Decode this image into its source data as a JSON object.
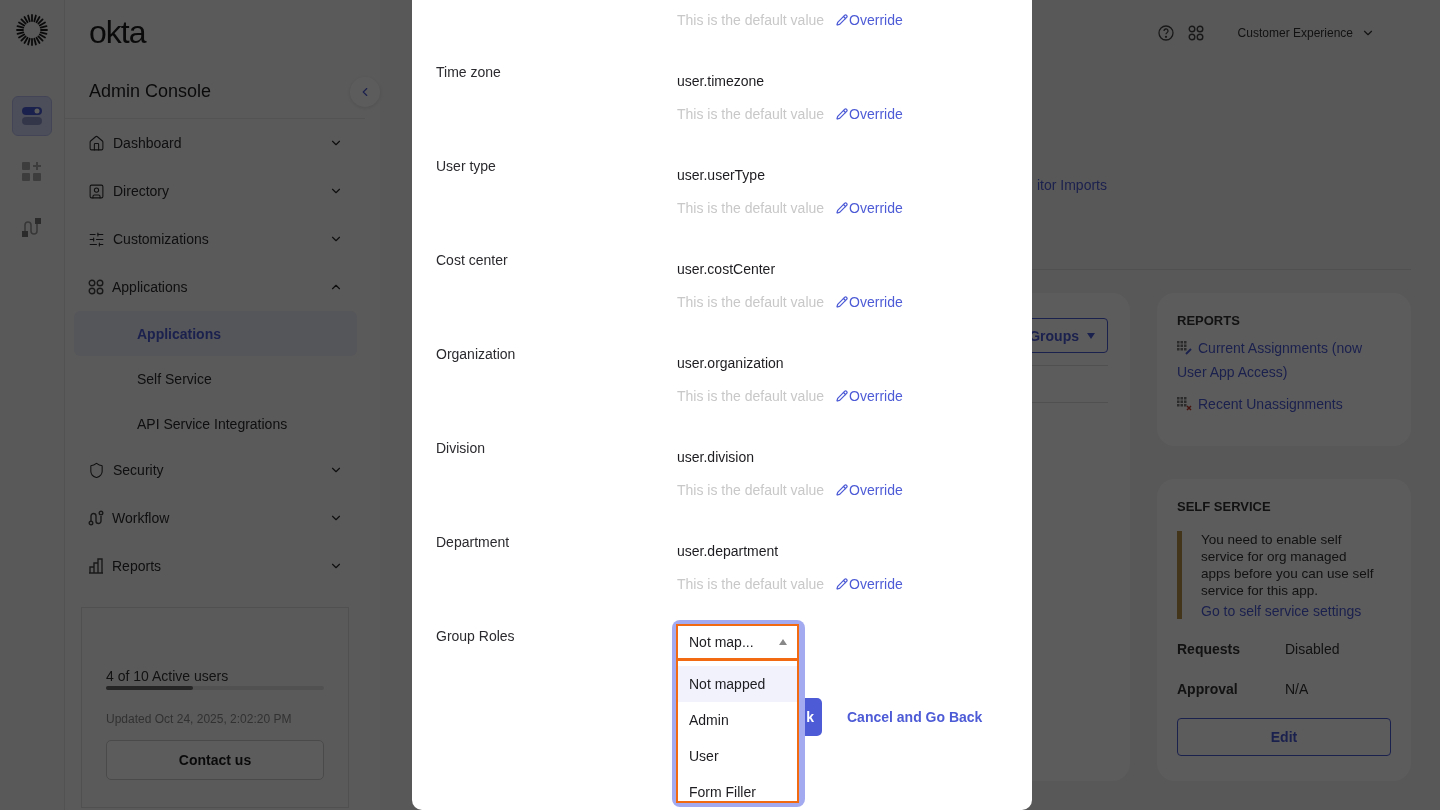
{
  "rail": {
    "items": [
      {
        "selected": true
      },
      {
        "selected": false
      },
      {
        "selected": false
      }
    ]
  },
  "logo": "okta",
  "sidebar": {
    "title": "Admin Console",
    "items": [
      {
        "label": "Dashboard",
        "expanded": false
      },
      {
        "label": "Directory",
        "expanded": false
      },
      {
        "label": "Customizations",
        "expanded": false
      },
      {
        "label": "Applications",
        "expanded": true,
        "children": [
          {
            "label": "Applications",
            "selected": true
          },
          {
            "label": "Self Service",
            "selected": false
          },
          {
            "label": "API Service Integrations",
            "selected": false
          }
        ]
      },
      {
        "label": "Security",
        "expanded": false
      },
      {
        "label": "Workflow",
        "expanded": false
      },
      {
        "label": "Reports",
        "expanded": false
      }
    ]
  },
  "usage_card": {
    "text": "4 of 10 Active users",
    "level": 0.4,
    "updated": "Updated Oct 24, 2025, 2:02:20 PM",
    "button": "Contact us"
  },
  "header": {
    "org": "Customer Experience"
  },
  "main": {
    "link": "itor Imports",
    "groups_button": "Groups"
  },
  "reports": {
    "title": "REPORTS",
    "links": [
      {
        "kind": "edit",
        "label": "Current Assignments (now User App Access)"
      },
      {
        "kind": "remove",
        "label": "Recent Unassignments"
      }
    ]
  },
  "self_service": {
    "title": "SELF SERVICE",
    "notice": "You need to enable self service for org managed apps before you can use self service for this app.",
    "notice_link": "Go to self service settings",
    "fields": [
      {
        "label": "Requests",
        "value": "Disabled"
      },
      {
        "label": "Approval",
        "value": "N/A"
      }
    ],
    "button": "Edit"
  },
  "modal": {
    "rows": [
      {
        "hint": "This is the default value",
        "action": "Override"
      },
      {
        "label": "Time zone",
        "value": "user.timezone",
        "hint": "This is the default value",
        "action": "Override"
      },
      {
        "label": "User type",
        "value": "user.userType",
        "hint": "This is the default value",
        "action": "Override"
      },
      {
        "label": "Cost center",
        "value": "user.costCenter",
        "hint": "This is the default value",
        "action": "Override"
      },
      {
        "label": "Organization",
        "value": "user.organization",
        "hint": "This is the default value",
        "action": "Override"
      },
      {
        "label": "Division",
        "value": "user.division",
        "hint": "This is the default value",
        "action": "Override"
      },
      {
        "label": "Department",
        "value": "user.department",
        "hint": "This is the default value",
        "action": "Override"
      }
    ],
    "group_roles": {
      "label": "Group Roles",
      "select": {
        "value": "Not map...",
        "expanded": true,
        "options": [
          {
            "label": "Not mapped",
            "selected": true
          },
          {
            "label": "Admin",
            "selected": false
          },
          {
            "label": "User",
            "selected": false
          },
          {
            "label": "Form Filler",
            "selected": false
          }
        ]
      }
    },
    "buttons": {
      "primary": "k",
      "cancel": "Cancel and Go Back"
    }
  }
}
